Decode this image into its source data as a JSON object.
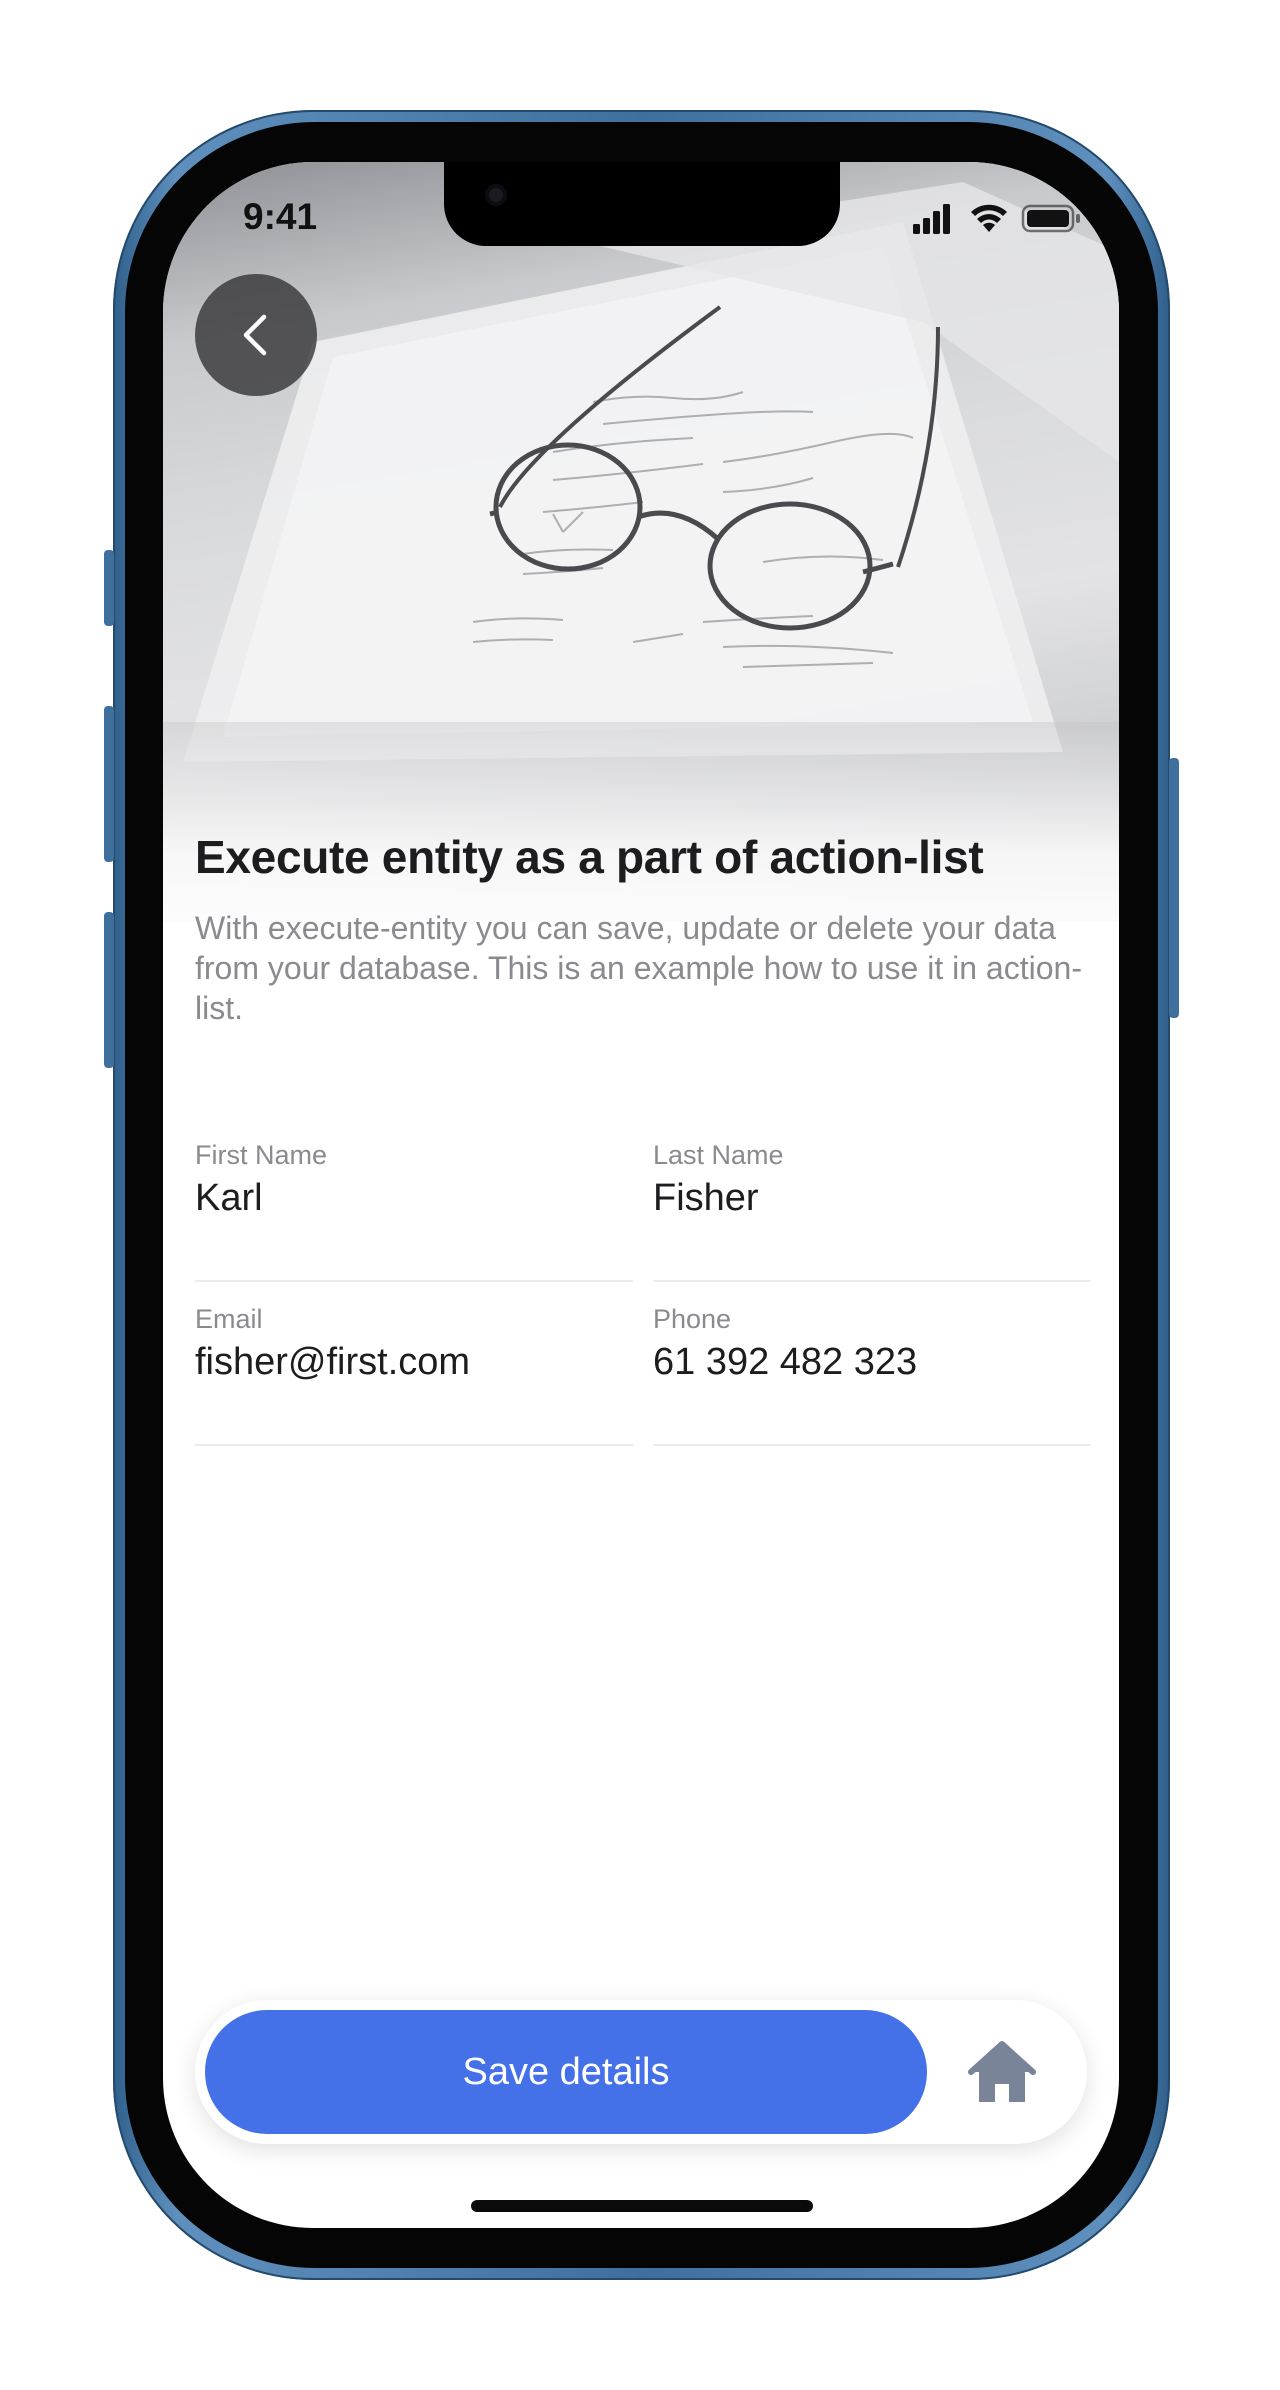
{
  "status_bar": {
    "time": "9:41",
    "icons": [
      "signal-icon",
      "wifi-icon",
      "battery-icon"
    ]
  },
  "hero": {
    "image": "glasses-on-notebook-photo",
    "back_icon": "chevron-left-icon"
  },
  "content": {
    "title": "Execute entity as a part of action-list",
    "description": "With execute-entity you can save, update or delete your data from your database. This is an example how to use it in action-list."
  },
  "form": {
    "fields": [
      {
        "label": "First Name",
        "value": "Karl"
      },
      {
        "label": "Last Name",
        "value": "Fisher"
      },
      {
        "label": "Email",
        "value": "fisher@first.com"
      },
      {
        "label": "Phone",
        "value": "61 392 482 323"
      }
    ]
  },
  "bottom_bar": {
    "save_label": "Save details",
    "home_icon": "home-icon"
  },
  "colors": {
    "accent": "#4470e8",
    "home_icon": "#7a8498",
    "title": "#1d1d1f",
    "muted_text": "#8a8a8f",
    "phone_frame": "#3f6f9c"
  }
}
